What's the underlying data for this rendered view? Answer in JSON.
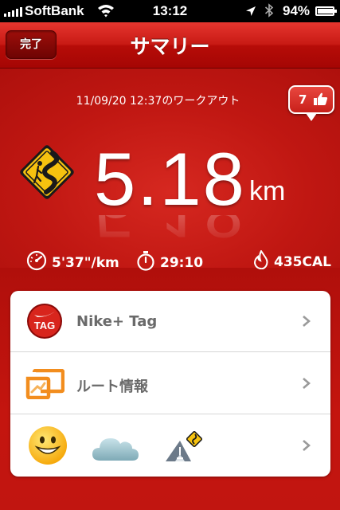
{
  "status_bar": {
    "carrier": "SoftBank",
    "time": "13:12",
    "battery": "94%",
    "battery_level": 0.94
  },
  "nav": {
    "done_label": "完了",
    "title": "サマリー"
  },
  "summary": {
    "workout_datetime": "11/09/20 12:37",
    "workout_suffix": "のワークアウト",
    "cheers_count": "7",
    "distance_value": "5.18",
    "distance_unit": "km",
    "pace": "5'37\"/km",
    "duration": "29:10",
    "calories": "435CAL"
  },
  "rows": [
    {
      "label": "Nike+ Tag",
      "icon": "nike-tag-icon"
    },
    {
      "label": "ルート情報",
      "icon": "route-icon"
    },
    {
      "label": "",
      "icons": [
        "smiley-icon",
        "cloud-icon",
        "terrain-icon"
      ]
    }
  ],
  "colors": {
    "brand_red": "#c8201a",
    "sign_yellow": "#f6c20f",
    "route_orange": "#f28d1e",
    "text_gray": "#6a6a6a"
  },
  "tag_icon_text": "TAG"
}
